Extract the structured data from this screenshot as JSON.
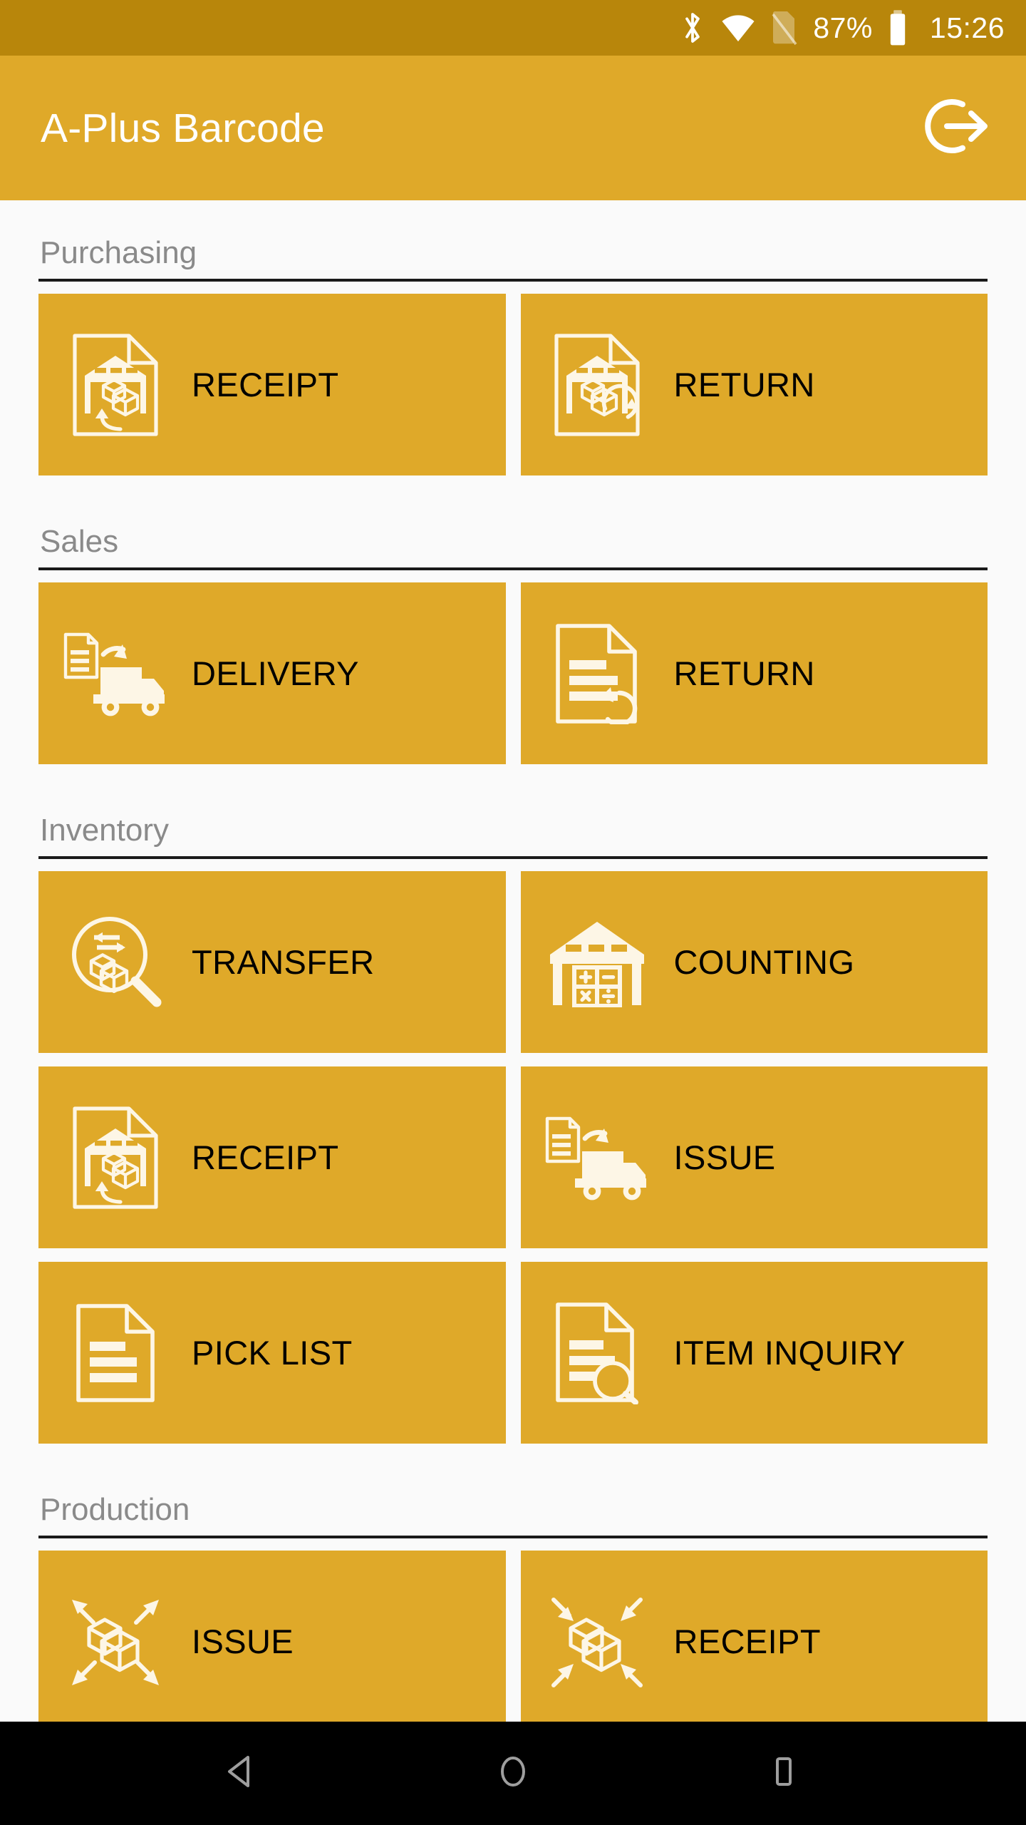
{
  "status_bar": {
    "background": "#b8860b",
    "battery_percent": "87%",
    "time": "15:26",
    "icons": [
      "bluetooth-icon",
      "wifi-icon",
      "no-sim-icon",
      "battery-icon"
    ]
  },
  "app_bar": {
    "background": "#dfa929",
    "title": "A-Plus Barcode",
    "action_icon": "logout-icon"
  },
  "theme": {
    "tile_color": "#dfa929",
    "tile_label_color": "#000000",
    "section_title_color": "#8a8a8a",
    "page_background": "#fafafa"
  },
  "sections": [
    {
      "title": "Purchasing",
      "rows": [
        [
          {
            "label": "RECEIPT",
            "icon": "document-warehouse-inbound-icon"
          },
          {
            "label": "RETURN",
            "icon": "document-warehouse-return-icon"
          }
        ]
      ]
    },
    {
      "title": "Sales",
      "rows": [
        [
          {
            "label": "DELIVERY",
            "icon": "document-truck-icon"
          },
          {
            "label": "RETURN",
            "icon": "document-lines-return-icon"
          }
        ]
      ]
    },
    {
      "title": "Inventory",
      "rows": [
        [
          {
            "label": "TRANSFER",
            "icon": "magnifier-boxes-transfer-icon"
          },
          {
            "label": "COUNTING",
            "icon": "warehouse-calculator-icon"
          }
        ],
        [
          {
            "label": "RECEIPT",
            "icon": "document-warehouse-inbound-icon"
          },
          {
            "label": "ISSUE",
            "icon": "document-truck-icon"
          }
        ],
        [
          {
            "label": "PICK LIST",
            "icon": "document-lines-icon"
          },
          {
            "label": "ITEM INQUIRY",
            "icon": "document-magnifier-icon"
          }
        ]
      ]
    },
    {
      "title": "Production",
      "rows": [
        [
          {
            "label": "ISSUE",
            "icon": "boxes-arrows-out-icon"
          },
          {
            "label": "RECEIPT",
            "icon": "boxes-arrows-in-icon"
          }
        ]
      ]
    }
  ],
  "nav_bar": {
    "background": "#000000",
    "buttons": [
      "back-icon",
      "home-icon",
      "recents-icon"
    ]
  }
}
